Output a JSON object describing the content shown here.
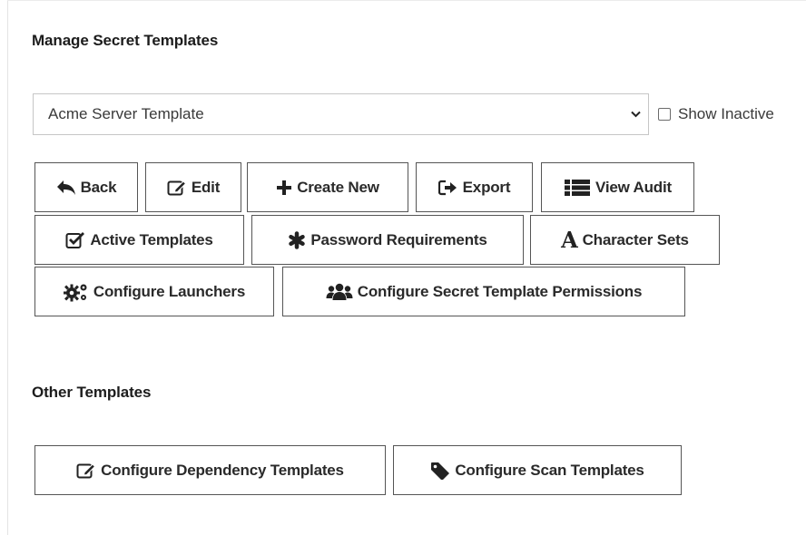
{
  "sections": {
    "manage_title": "Manage Secret Templates",
    "other_title": "Other Templates"
  },
  "template_select": {
    "selected": "Acme Server Template",
    "chevron_icon": "chevron-down-icon"
  },
  "show_inactive": {
    "label": "Show Inactive",
    "checked": false
  },
  "buttons": {
    "back": {
      "label": "Back",
      "icon": "reply-arrow-icon"
    },
    "edit": {
      "label": "Edit",
      "icon": "edit-icon"
    },
    "create_new": {
      "label": "Create New",
      "icon": "plus-icon"
    },
    "export": {
      "label": "Export",
      "icon": "export-icon"
    },
    "view_audit": {
      "label": "View Audit",
      "icon": "list-icon"
    },
    "active_templates": {
      "label": "Active Templates",
      "icon": "check-square-icon"
    },
    "password_requirements": {
      "label": "Password Requirements",
      "icon": "asterisk-icon"
    },
    "character_sets": {
      "label": "Character Sets",
      "icon": "font-icon",
      "icon_glyph": "A"
    },
    "configure_launchers": {
      "label": "Configure Launchers",
      "icon": "gears-icon"
    },
    "configure_permissions": {
      "label": "Configure Secret Template Permissions",
      "icon": "users-icon"
    },
    "configure_dependency": {
      "label": "Configure Dependency Templates",
      "icon": "edit-icon"
    },
    "configure_scan": {
      "label": "Configure Scan Templates",
      "icon": "tag-icon"
    }
  },
  "colors": {
    "text": "#2a2a2a",
    "border": "#555555",
    "input_border": "#c6c6c6"
  }
}
